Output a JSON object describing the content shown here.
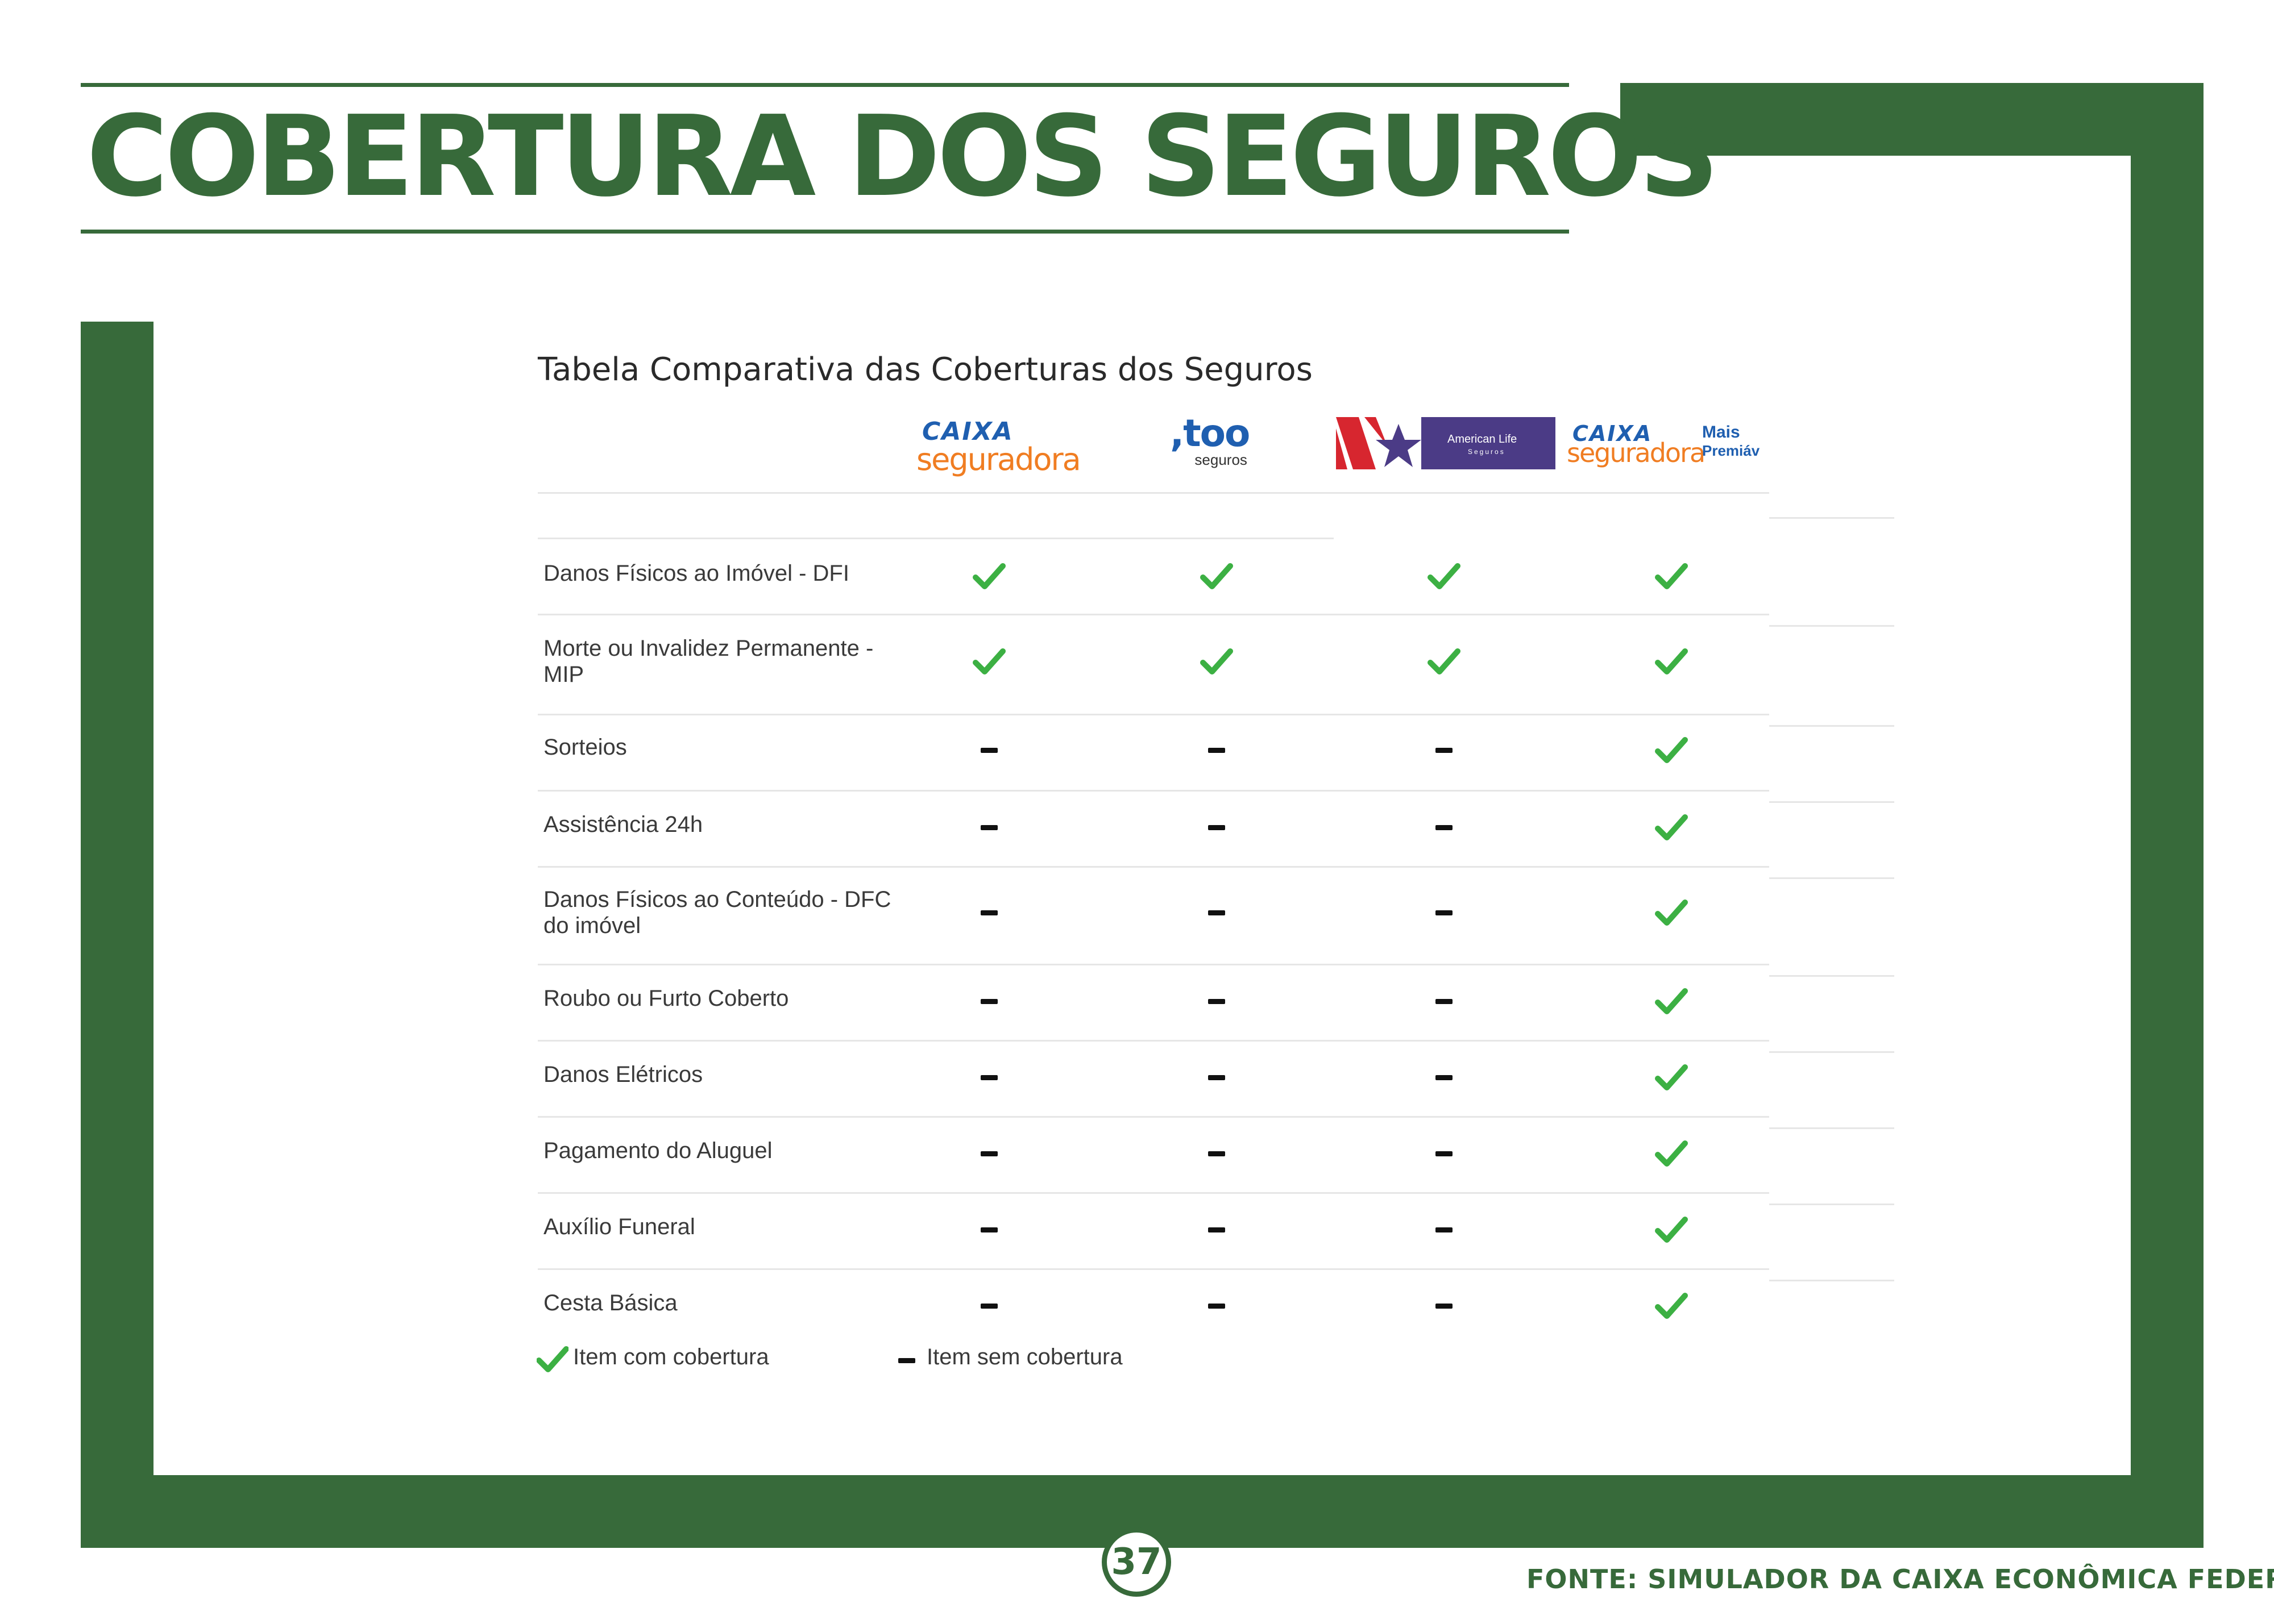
{
  "title": "COBERTURA DOS SEGUROS",
  "table": {
    "title": "Tabela Comparativa das Coberturas dos Seguros",
    "insurers": [
      {
        "logo": "caixa-seguradora-logo",
        "line1": "CAIXA",
        "line2": "seguradora"
      },
      {
        "logo": "too-seguros-logo",
        "line1": ",too",
        "line2": "seguros"
      },
      {
        "logo": "american-life-logo",
        "line1": "American Life",
        "line2": "Seguros"
      },
      {
        "logo": "caixa-seguradora-mais-premiavel-logo",
        "line1": "CAIXA",
        "line2": "seguradora",
        "badge1": "Mais",
        "badge2": "Premiáv"
      }
    ],
    "rows": [
      {
        "label": "Danos Físicos ao Imóvel - DFI",
        "coverage": [
          true,
          true,
          true,
          true
        ]
      },
      {
        "label": "Morte ou Invalidez Permanente - MIP",
        "coverage": [
          true,
          true,
          true,
          true
        ]
      },
      {
        "label": "Sorteios",
        "coverage": [
          false,
          false,
          false,
          true
        ]
      },
      {
        "label": "Assistência 24h",
        "coverage": [
          false,
          false,
          false,
          true
        ]
      },
      {
        "label": "Danos Físicos ao Conteúdo - DFC do imóvel",
        "coverage": [
          false,
          false,
          false,
          true
        ]
      },
      {
        "label": "Roubo ou Furto Coberto",
        "coverage": [
          false,
          false,
          false,
          true
        ]
      },
      {
        "label": "Danos Elétricos",
        "coverage": [
          false,
          false,
          false,
          true
        ]
      },
      {
        "label": "Pagamento do Aluguel",
        "coverage": [
          false,
          false,
          false,
          true
        ]
      },
      {
        "label": "Auxílio Funeral",
        "coverage": [
          false,
          false,
          false,
          true
        ]
      },
      {
        "label": "Cesta Básica",
        "coverage": [
          false,
          false,
          false,
          true
        ]
      }
    ],
    "legend": {
      "covered": "Item com cobertura",
      "not_covered": "Item sem cobertura"
    }
  },
  "colors": {
    "brand_green": "#376a3a",
    "check_green": "#3cb043",
    "caixa_blue": "#1f5fb0",
    "caixa_orange": "#f07d22",
    "american_life_purple": "#4b3b86",
    "american_life_red": "#d7262f"
  },
  "page_number": "37",
  "source": "FONTE: SIMULADOR DA CAIXA ECONÔMICA FEDERAL"
}
